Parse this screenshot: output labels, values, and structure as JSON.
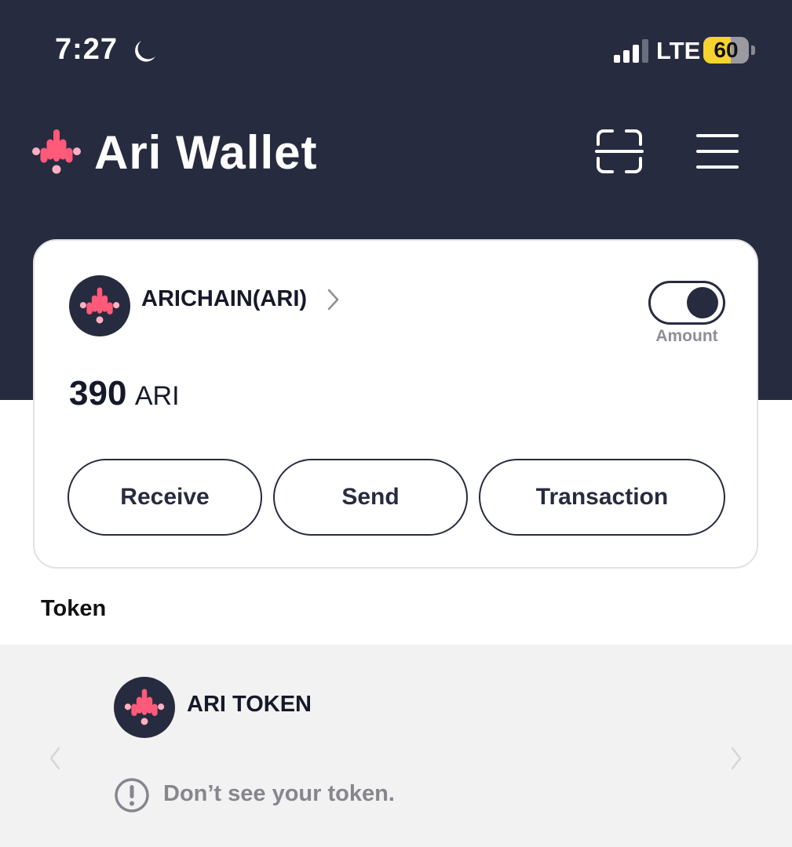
{
  "status_bar": {
    "time": "7:27",
    "network": "LTE",
    "battery_level": "60",
    "battery_fraction": 0.6,
    "icons": [
      "moon-icon",
      "signal-icon",
      "battery-icon"
    ]
  },
  "header": {
    "title": "Ari Wallet",
    "icons": [
      "ari-logo-icon",
      "qr-scan-icon",
      "hamburger-menu-icon"
    ]
  },
  "wallet_card": {
    "network_name": "ARICHAIN(ARI)",
    "toggle_label": "Amount",
    "toggle_on": true,
    "balance_value": "390",
    "balance_unit": "ARI",
    "actions": {
      "receive": "Receive",
      "send": "Send",
      "transaction": "Transaction"
    }
  },
  "tokens": {
    "section_title": "Token",
    "items": [
      {
        "name": "ARI TOKEN"
      }
    ],
    "missing_token_text": "Don’t see your token."
  },
  "colors": {
    "header_bg": "#272b3f",
    "brand_pink": "#ff5a7a",
    "brand_light_pink": "#ffb0c2",
    "battery_yellow": "#f6d32d",
    "panel_bg": "#f2f2f2",
    "muted_text": "#86868e"
  }
}
